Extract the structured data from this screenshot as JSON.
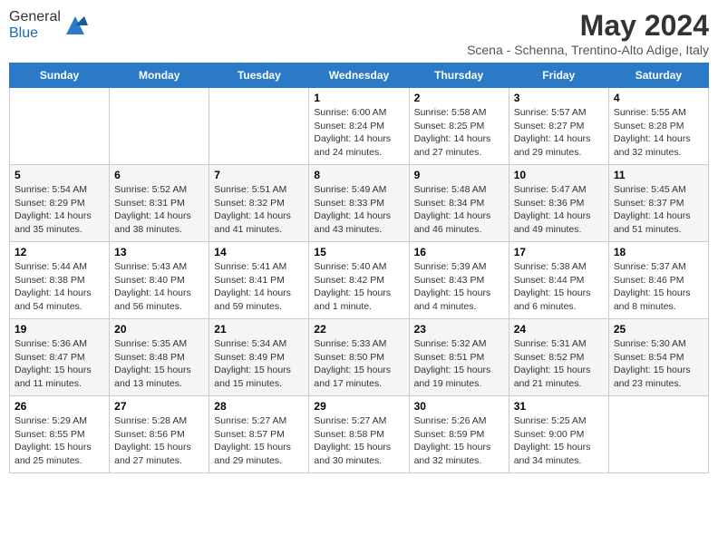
{
  "logo": {
    "general": "General",
    "blue": "Blue"
  },
  "title": "May 2024",
  "location": "Scena - Schenna, Trentino-Alto Adige, Italy",
  "days_of_week": [
    "Sunday",
    "Monday",
    "Tuesday",
    "Wednesday",
    "Thursday",
    "Friday",
    "Saturday"
  ],
  "weeks": [
    [
      {
        "day": "",
        "info": ""
      },
      {
        "day": "",
        "info": ""
      },
      {
        "day": "",
        "info": ""
      },
      {
        "day": "1",
        "info": "Sunrise: 6:00 AM\nSunset: 8:24 PM\nDaylight: 14 hours and 24 minutes."
      },
      {
        "day": "2",
        "info": "Sunrise: 5:58 AM\nSunset: 8:25 PM\nDaylight: 14 hours and 27 minutes."
      },
      {
        "day": "3",
        "info": "Sunrise: 5:57 AM\nSunset: 8:27 PM\nDaylight: 14 hours and 29 minutes."
      },
      {
        "day": "4",
        "info": "Sunrise: 5:55 AM\nSunset: 8:28 PM\nDaylight: 14 hours and 32 minutes."
      }
    ],
    [
      {
        "day": "5",
        "info": "Sunrise: 5:54 AM\nSunset: 8:29 PM\nDaylight: 14 hours and 35 minutes."
      },
      {
        "day": "6",
        "info": "Sunrise: 5:52 AM\nSunset: 8:31 PM\nDaylight: 14 hours and 38 minutes."
      },
      {
        "day": "7",
        "info": "Sunrise: 5:51 AM\nSunset: 8:32 PM\nDaylight: 14 hours and 41 minutes."
      },
      {
        "day": "8",
        "info": "Sunrise: 5:49 AM\nSunset: 8:33 PM\nDaylight: 14 hours and 43 minutes."
      },
      {
        "day": "9",
        "info": "Sunrise: 5:48 AM\nSunset: 8:34 PM\nDaylight: 14 hours and 46 minutes."
      },
      {
        "day": "10",
        "info": "Sunrise: 5:47 AM\nSunset: 8:36 PM\nDaylight: 14 hours and 49 minutes."
      },
      {
        "day": "11",
        "info": "Sunrise: 5:45 AM\nSunset: 8:37 PM\nDaylight: 14 hours and 51 minutes."
      }
    ],
    [
      {
        "day": "12",
        "info": "Sunrise: 5:44 AM\nSunset: 8:38 PM\nDaylight: 14 hours and 54 minutes."
      },
      {
        "day": "13",
        "info": "Sunrise: 5:43 AM\nSunset: 8:40 PM\nDaylight: 14 hours and 56 minutes."
      },
      {
        "day": "14",
        "info": "Sunrise: 5:41 AM\nSunset: 8:41 PM\nDaylight: 14 hours and 59 minutes."
      },
      {
        "day": "15",
        "info": "Sunrise: 5:40 AM\nSunset: 8:42 PM\nDaylight: 15 hours and 1 minute."
      },
      {
        "day": "16",
        "info": "Sunrise: 5:39 AM\nSunset: 8:43 PM\nDaylight: 15 hours and 4 minutes."
      },
      {
        "day": "17",
        "info": "Sunrise: 5:38 AM\nSunset: 8:44 PM\nDaylight: 15 hours and 6 minutes."
      },
      {
        "day": "18",
        "info": "Sunrise: 5:37 AM\nSunset: 8:46 PM\nDaylight: 15 hours and 8 minutes."
      }
    ],
    [
      {
        "day": "19",
        "info": "Sunrise: 5:36 AM\nSunset: 8:47 PM\nDaylight: 15 hours and 11 minutes."
      },
      {
        "day": "20",
        "info": "Sunrise: 5:35 AM\nSunset: 8:48 PM\nDaylight: 15 hours and 13 minutes."
      },
      {
        "day": "21",
        "info": "Sunrise: 5:34 AM\nSunset: 8:49 PM\nDaylight: 15 hours and 15 minutes."
      },
      {
        "day": "22",
        "info": "Sunrise: 5:33 AM\nSunset: 8:50 PM\nDaylight: 15 hours and 17 minutes."
      },
      {
        "day": "23",
        "info": "Sunrise: 5:32 AM\nSunset: 8:51 PM\nDaylight: 15 hours and 19 minutes."
      },
      {
        "day": "24",
        "info": "Sunrise: 5:31 AM\nSunset: 8:52 PM\nDaylight: 15 hours and 21 minutes."
      },
      {
        "day": "25",
        "info": "Sunrise: 5:30 AM\nSunset: 8:54 PM\nDaylight: 15 hours and 23 minutes."
      }
    ],
    [
      {
        "day": "26",
        "info": "Sunrise: 5:29 AM\nSunset: 8:55 PM\nDaylight: 15 hours and 25 minutes."
      },
      {
        "day": "27",
        "info": "Sunrise: 5:28 AM\nSunset: 8:56 PM\nDaylight: 15 hours and 27 minutes."
      },
      {
        "day": "28",
        "info": "Sunrise: 5:27 AM\nSunset: 8:57 PM\nDaylight: 15 hours and 29 minutes."
      },
      {
        "day": "29",
        "info": "Sunrise: 5:27 AM\nSunset: 8:58 PM\nDaylight: 15 hours and 30 minutes."
      },
      {
        "day": "30",
        "info": "Sunrise: 5:26 AM\nSunset: 8:59 PM\nDaylight: 15 hours and 32 minutes."
      },
      {
        "day": "31",
        "info": "Sunrise: 5:25 AM\nSunset: 9:00 PM\nDaylight: 15 hours and 34 minutes."
      },
      {
        "day": "",
        "info": ""
      }
    ]
  ]
}
